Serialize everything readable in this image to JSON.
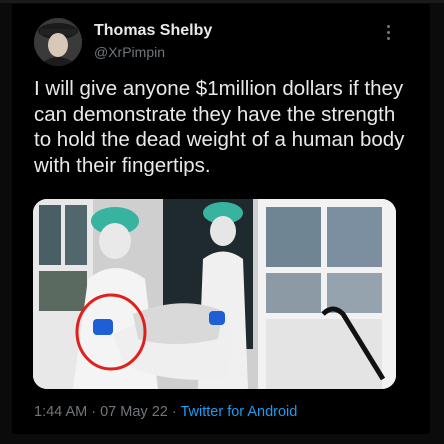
{
  "tweet": {
    "author_name": "Thomas Shelby",
    "author_handle": "@XrPimpin",
    "text": "I will give anyone $1million dollars if they can demonstrate they have the strength to hold the dead weight of a human body with their fingertips.",
    "time": "1:44 AM",
    "date": "07 May 22",
    "client": "Twitter for Android",
    "separator": "·"
  },
  "icons": {
    "more": "more-vertical-icon",
    "avatar": "avatar"
  },
  "colors": {
    "background": "#000000",
    "text": "#e7e9ea",
    "muted": "#71767b",
    "link": "#1d9bf0",
    "circle_annotation": "#e0201a"
  }
}
